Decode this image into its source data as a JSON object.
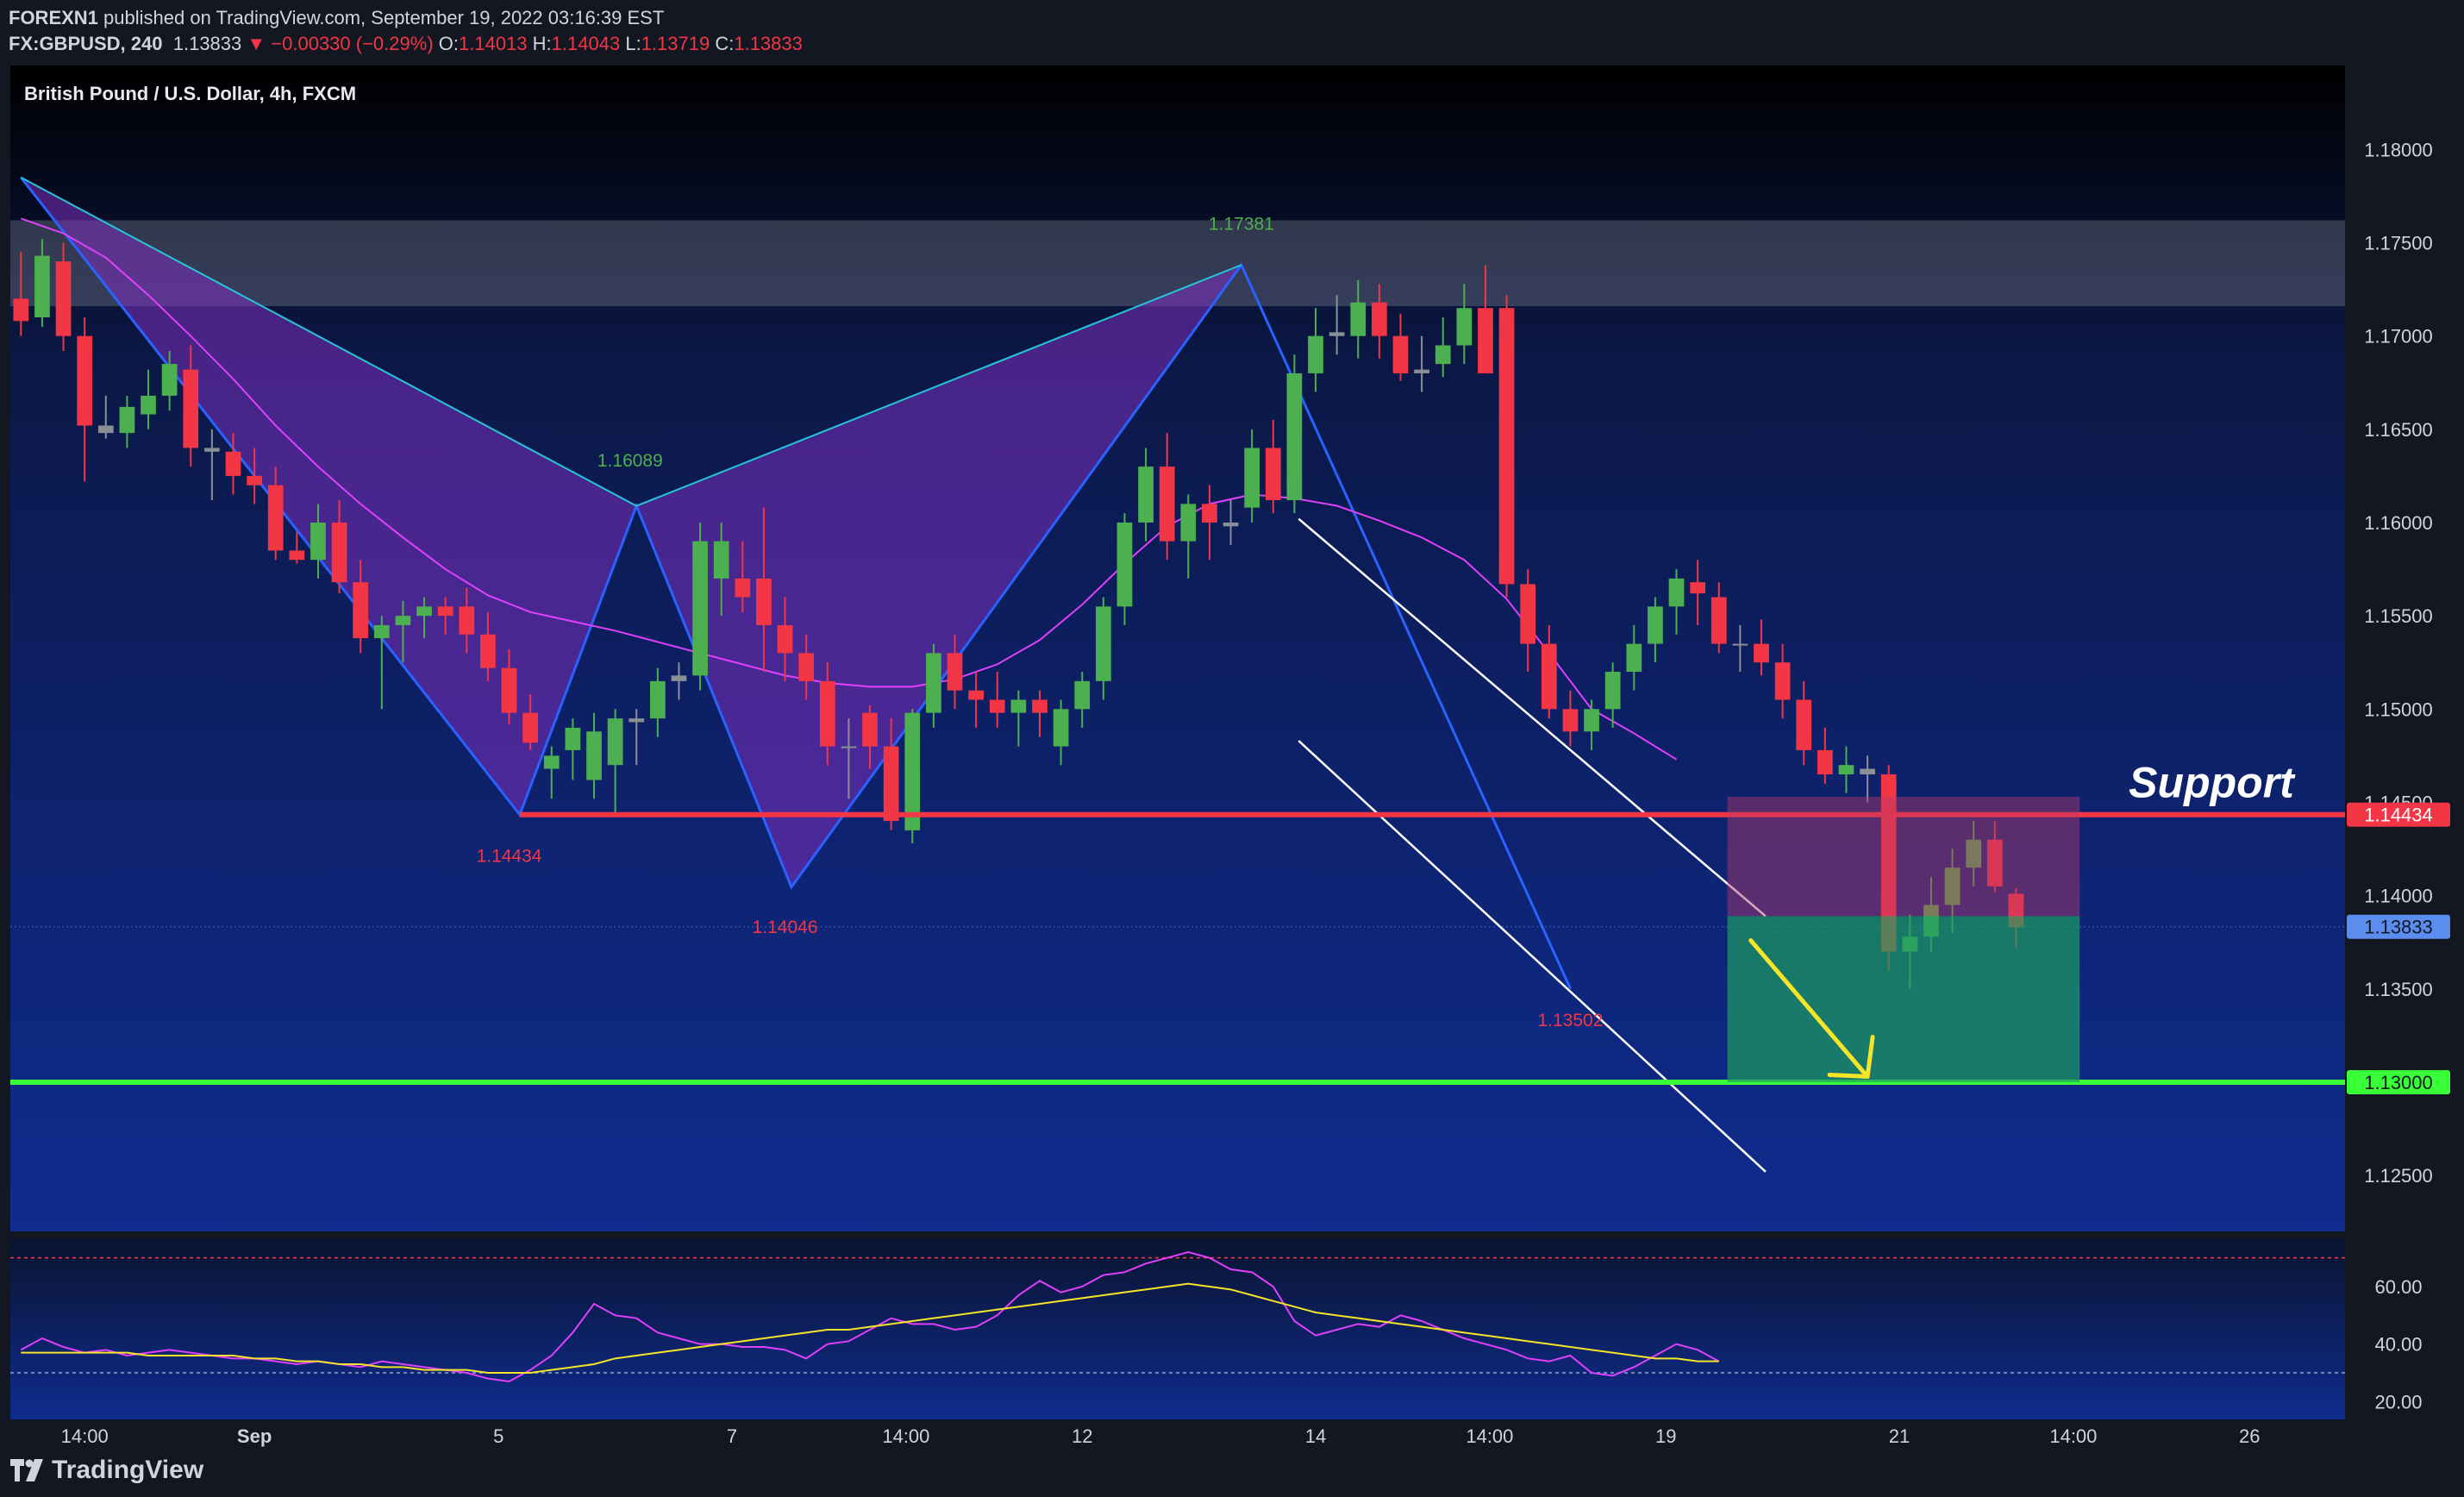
{
  "header": {
    "publisher": "FOREXN1",
    "published_text": "published on TradingView.com, September 19, 2022 03:16:39 EST",
    "symbol": "FX:GBPUSD, 240",
    "last": "1.13833",
    "change": "▼ −0.00330 (−0.29%)",
    "o_label": "O:",
    "o_value": "1.14013",
    "h_label": "H:",
    "h_value": "1.14043",
    "l_label": "L:",
    "l_value": "1.13719",
    "c_label": "C:",
    "c_value": "1.13833"
  },
  "chart_title": "British Pound / U.S. Dollar, 4h, FXCM",
  "footer": {
    "brand": "TradingView"
  },
  "colors": {
    "up": "#4caf50",
    "down": "#f23645",
    "neutral": "#8a8f96",
    "support": "#f23645",
    "target": "#39ff39",
    "pattern": "#2962ff",
    "ma": "#e040fb",
    "arrow": "#f5e428"
  },
  "chart_data": {
    "type": "candlestick",
    "y_axis": {
      "min": 1.122,
      "max": 1.1845,
      "ticks": [
        "1.18000",
        "1.17500",
        "1.17000",
        "1.16500",
        "1.16000",
        "1.15500",
        "1.15000",
        "1.14500",
        "1.14000",
        "1.13500",
        "1.13000",
        "1.12500"
      ]
    },
    "x_axis": {
      "bars": 110,
      "ticks": [
        {
          "label": "14:00",
          "bar": 3
        },
        {
          "label": "Sep",
          "bar": 11
        },
        {
          "label": "5",
          "bar": 22.5
        },
        {
          "label": "7",
          "bar": 33.5
        },
        {
          "label": "14:00",
          "bar": 41.7
        },
        {
          "label": "12",
          "bar": 50
        },
        {
          "label": "14",
          "bar": 61
        },
        {
          "label": "14:00",
          "bar": 69.2
        },
        {
          "label": "19",
          "bar": 77.5
        },
        {
          "label": "21",
          "bar": 88.5
        },
        {
          "label": "14:00",
          "bar": 96.7
        },
        {
          "label": "26",
          "bar": 105
        }
      ]
    },
    "resistance_zone": {
      "from": 1.1716,
      "to": 1.1762
    },
    "price_labels": [
      {
        "value": 1.14434,
        "text": "1.14434",
        "bg": "#f23645",
        "color": "#ffffff"
      },
      {
        "value": 1.13833,
        "text": "1.13833",
        "bg": "#5b8def",
        "color": "#131722"
      },
      {
        "value": 1.13,
        "text": "1.13000",
        "bg": "#39ff39",
        "color": "#131722"
      }
    ],
    "support_line": {
      "value": 1.14434,
      "from_bar": 23.5,
      "label": "Support"
    },
    "target_line": {
      "value": 1.13
    },
    "pivot_labels": [
      {
        "text": "1.17381",
        "bar": 57.5,
        "price": 1.1757,
        "color": "#4caf50"
      },
      {
        "text": "1.16089",
        "bar": 28.7,
        "price": 1.163,
        "color": "#4caf50"
      },
      {
        "text": "1.14434",
        "bar": 23,
        "price": 1.1418,
        "color": "#f23645"
      },
      {
        "text": "1.14046",
        "bar": 36,
        "price": 1.138,
        "color": "#f23645"
      },
      {
        "text": "1.13502",
        "bar": 73,
        "price": 1.133,
        "color": "#f23645"
      }
    ],
    "pattern_points": [
      {
        "bar": 0,
        "price": 1.1785
      },
      {
        "bar": 23.5,
        "price": 1.14434
      },
      {
        "bar": 29,
        "price": 1.16089
      },
      {
        "bar": 36.3,
        "price": 1.14046
      },
      {
        "bar": 57.5,
        "price": 1.17381
      },
      {
        "bar": 73,
        "price": 1.13502
      }
    ],
    "pattern_fill": "#7b2fbe",
    "channel": [
      {
        "from": {
          "bar": 60.2,
          "price": 1.1602
        },
        "to": {
          "bar": 82.2,
          "price": 1.1389
        }
      },
      {
        "from": {
          "bar": 60.2,
          "price": 1.1483
        },
        "to": {
          "bar": 82.2,
          "price": 1.1252
        }
      }
    ],
    "position": {
      "from_bar": 80.4,
      "to_bar": 97,
      "entry": 1.1389,
      "stop": 1.1453,
      "target": 1.13
    },
    "arrow": {
      "from": {
        "bar": 81.5,
        "price": 1.1376
      },
      "to": {
        "bar": 87,
        "price": 1.1303
      }
    },
    "ma": [
      [
        0,
        1.1763
      ],
      [
        2,
        1.1755
      ],
      [
        4,
        1.1742
      ],
      [
        6,
        1.1722
      ],
      [
        8,
        1.17
      ],
      [
        10,
        1.1677
      ],
      [
        12,
        1.1652
      ],
      [
        14,
        1.163
      ],
      [
        16,
        1.161
      ],
      [
        18,
        1.1592
      ],
      [
        20,
        1.1575
      ],
      [
        22,
        1.1561
      ],
      [
        24,
        1.1552
      ],
      [
        26,
        1.1547
      ],
      [
        28,
        1.1542
      ],
      [
        30,
        1.1536
      ],
      [
        32,
        1.153
      ],
      [
        34,
        1.1524
      ],
      [
        36,
        1.1518
      ],
      [
        38,
        1.1514
      ],
      [
        40,
        1.1512
      ],
      [
        42,
        1.1512
      ],
      [
        44,
        1.1516
      ],
      [
        46,
        1.1524
      ],
      [
        48,
        1.1537
      ],
      [
        50,
        1.1556
      ],
      [
        52,
        1.1578
      ],
      [
        54,
        1.1598
      ],
      [
        56,
        1.161
      ],
      [
        58,
        1.1615
      ],
      [
        60,
        1.1613
      ],
      [
        62,
        1.1609
      ],
      [
        64,
        1.1601
      ],
      [
        66,
        1.1592
      ],
      [
        68,
        1.158
      ],
      [
        70,
        1.1559
      ],
      [
        72,
        1.153
      ],
      [
        74,
        1.15
      ],
      [
        76,
        1.1487
      ],
      [
        78,
        1.1473
      ]
    ],
    "candles": [
      {
        "o": 1.172,
        "h": 1.1745,
        "l": 1.17,
        "c": 1.1708
      },
      {
        "o": 1.171,
        "h": 1.1752,
        "l": 1.1705,
        "c": 1.1743
      },
      {
        "o": 1.174,
        "h": 1.175,
        "l": 1.1692,
        "c": 1.17
      },
      {
        "o": 1.17,
        "h": 1.171,
        "l": 1.1622,
        "c": 1.1652
      },
      {
        "o": 1.1652,
        "h": 1.1668,
        "l": 1.1645,
        "c": 1.1648
      },
      {
        "o": 1.1648,
        "h": 1.1668,
        "l": 1.164,
        "c": 1.1662
      },
      {
        "o": 1.1658,
        "h": 1.1682,
        "l": 1.165,
        "c": 1.1668
      },
      {
        "o": 1.1668,
        "h": 1.1692,
        "l": 1.166,
        "c": 1.1685
      },
      {
        "o": 1.1682,
        "h": 1.1695,
        "l": 1.163,
        "c": 1.164
      },
      {
        "o": 1.164,
        "h": 1.165,
        "l": 1.1612,
        "c": 1.1638
      },
      {
        "o": 1.1638,
        "h": 1.1648,
        "l": 1.1615,
        "c": 1.1625
      },
      {
        "o": 1.1625,
        "h": 1.164,
        "l": 1.161,
        "c": 1.162
      },
      {
        "o": 1.162,
        "h": 1.163,
        "l": 1.158,
        "c": 1.1585
      },
      {
        "o": 1.1585,
        "h": 1.1595,
        "l": 1.1578,
        "c": 1.158
      },
      {
        "o": 1.158,
        "h": 1.161,
        "l": 1.157,
        "c": 1.16
      },
      {
        "o": 1.16,
        "h": 1.1612,
        "l": 1.1562,
        "c": 1.1568
      },
      {
        "o": 1.1568,
        "h": 1.158,
        "l": 1.153,
        "c": 1.1538
      },
      {
        "o": 1.1538,
        "h": 1.155,
        "l": 1.15,
        "c": 1.1545
      },
      {
        "o": 1.1545,
        "h": 1.1558,
        "l": 1.1525,
        "c": 1.155
      },
      {
        "o": 1.155,
        "h": 1.156,
        "l": 1.1538,
        "c": 1.1555
      },
      {
        "o": 1.1555,
        "h": 1.156,
        "l": 1.154,
        "c": 1.155
      },
      {
        "o": 1.1555,
        "h": 1.1565,
        "l": 1.153,
        "c": 1.154
      },
      {
        "o": 1.154,
        "h": 1.1552,
        "l": 1.1515,
        "c": 1.1522
      },
      {
        "o": 1.1522,
        "h": 1.1532,
        "l": 1.1492,
        "c": 1.1498
      },
      {
        "o": 1.1498,
        "h": 1.1508,
        "l": 1.1478,
        "c": 1.1482
      },
      {
        "o": 1.1468,
        "h": 1.148,
        "l": 1.1452,
        "c": 1.1475
      },
      {
        "o": 1.1478,
        "h": 1.1495,
        "l": 1.1462,
        "c": 1.149
      },
      {
        "o": 1.1462,
        "h": 1.1498,
        "l": 1.1452,
        "c": 1.1488
      },
      {
        "o": 1.147,
        "h": 1.15,
        "l": 1.1444,
        "c": 1.1495
      },
      {
        "o": 1.1493,
        "h": 1.15,
        "l": 1.147,
        "c": 1.1495
      },
      {
        "o": 1.1495,
        "h": 1.1522,
        "l": 1.1485,
        "c": 1.1515
      },
      {
        "o": 1.1515,
        "h": 1.1525,
        "l": 1.1505,
        "c": 1.1518
      },
      {
        "o": 1.1518,
        "h": 1.16,
        "l": 1.151,
        "c": 1.159
      },
      {
        "o": 1.157,
        "h": 1.16,
        "l": 1.155,
        "c": 1.159
      },
      {
        "o": 1.157,
        "h": 1.159,
        "l": 1.1552,
        "c": 1.156
      },
      {
        "o": 1.157,
        "h": 1.1608,
        "l": 1.152,
        "c": 1.1545
      },
      {
        "o": 1.1545,
        "h": 1.156,
        "l": 1.1515,
        "c": 1.153
      },
      {
        "o": 1.153,
        "h": 1.154,
        "l": 1.1505,
        "c": 1.1515
      },
      {
        "o": 1.1515,
        "h": 1.1525,
        "l": 1.147,
        "c": 1.148
      },
      {
        "o": 1.148,
        "h": 1.1495,
        "l": 1.1452,
        "c": 1.148
      },
      {
        "o": 1.1498,
        "h": 1.1502,
        "l": 1.1468,
        "c": 1.148
      },
      {
        "o": 1.148,
        "h": 1.1495,
        "l": 1.1435,
        "c": 1.144
      },
      {
        "o": 1.1435,
        "h": 1.15,
        "l": 1.1428,
        "c": 1.1498
      },
      {
        "o": 1.1498,
        "h": 1.1535,
        "l": 1.149,
        "c": 1.153
      },
      {
        "o": 1.153,
        "h": 1.154,
        "l": 1.15,
        "c": 1.151
      },
      {
        "o": 1.151,
        "h": 1.152,
        "l": 1.149,
        "c": 1.1505
      },
      {
        "o": 1.1505,
        "h": 1.152,
        "l": 1.149,
        "c": 1.1498
      },
      {
        "o": 1.1498,
        "h": 1.151,
        "l": 1.148,
        "c": 1.1505
      },
      {
        "o": 1.1505,
        "h": 1.151,
        "l": 1.1485,
        "c": 1.1498
      },
      {
        "o": 1.148,
        "h": 1.1505,
        "l": 1.147,
        "c": 1.15
      },
      {
        "o": 1.15,
        "h": 1.152,
        "l": 1.149,
        "c": 1.1515
      },
      {
        "o": 1.1515,
        "h": 1.156,
        "l": 1.1505,
        "c": 1.1555
      },
      {
        "o": 1.1555,
        "h": 1.1605,
        "l": 1.1545,
        "c": 1.16
      },
      {
        "o": 1.16,
        "h": 1.164,
        "l": 1.159,
        "c": 1.163
      },
      {
        "o": 1.163,
        "h": 1.1648,
        "l": 1.158,
        "c": 1.159
      },
      {
        "o": 1.159,
        "h": 1.1615,
        "l": 1.157,
        "c": 1.161
      },
      {
        "o": 1.161,
        "h": 1.162,
        "l": 1.158,
        "c": 1.16
      },
      {
        "o": 1.16,
        "h": 1.1612,
        "l": 1.1588,
        "c": 1.1598
      },
      {
        "o": 1.1608,
        "h": 1.165,
        "l": 1.16,
        "c": 1.164
      },
      {
        "o": 1.164,
        "h": 1.1655,
        "l": 1.1605,
        "c": 1.1612
      },
      {
        "o": 1.1612,
        "h": 1.169,
        "l": 1.1605,
        "c": 1.168
      },
      {
        "o": 1.168,
        "h": 1.1715,
        "l": 1.167,
        "c": 1.17
      },
      {
        "o": 1.17,
        "h": 1.1722,
        "l": 1.169,
        "c": 1.1702
      },
      {
        "o": 1.17,
        "h": 1.173,
        "l": 1.1688,
        "c": 1.1718
      },
      {
        "o": 1.1718,
        "h": 1.1728,
        "l": 1.1688,
        "c": 1.17
      },
      {
        "o": 1.17,
        "h": 1.1712,
        "l": 1.1676,
        "c": 1.168
      },
      {
        "o": 1.168,
        "h": 1.17,
        "l": 1.167,
        "c": 1.1682
      },
      {
        "o": 1.1685,
        "h": 1.171,
        "l": 1.1678,
        "c": 1.1695
      },
      {
        "o": 1.1695,
        "h": 1.1728,
        "l": 1.1685,
        "c": 1.1715
      },
      {
        "o": 1.1715,
        "h": 1.1738,
        "l": 1.17,
        "c": 1.168
      }
    ],
    "candles2": [
      {
        "o": 1.1715,
        "h": 1.1722,
        "l": 1.156,
        "c": 1.1567
      },
      {
        "o": 1.1567,
        "h": 1.1575,
        "l": 1.152,
        "c": 1.1535
      },
      {
        "o": 1.1535,
        "h": 1.1545,
        "l": 1.1495,
        "c": 1.15
      },
      {
        "o": 1.15,
        "h": 1.151,
        "l": 1.148,
        "c": 1.1488
      },
      {
        "o": 1.1488,
        "h": 1.1505,
        "l": 1.1478,
        "c": 1.15
      },
      {
        "o": 1.15,
        "h": 1.1525,
        "l": 1.149,
        "c": 1.152
      },
      {
        "o": 1.152,
        "h": 1.1545,
        "l": 1.151,
        "c": 1.1535
      },
      {
        "o": 1.1535,
        "h": 1.156,
        "l": 1.1525,
        "c": 1.1555
      },
      {
        "o": 1.1555,
        "h": 1.1575,
        "l": 1.154,
        "c": 1.157
      },
      {
        "o": 1.1568,
        "h": 1.158,
        "l": 1.1545,
        "c": 1.1562
      },
      {
        "o": 1.156,
        "h": 1.1568,
        "l": 1.153,
        "c": 1.1535
      },
      {
        "o": 1.1535,
        "h": 1.1545,
        "l": 1.152,
        "c": 1.1535
      },
      {
        "o": 1.1535,
        "h": 1.1548,
        "l": 1.1518,
        "c": 1.1525
      },
      {
        "o": 1.1525,
        "h": 1.1535,
        "l": 1.1495,
        "c": 1.1505
      },
      {
        "o": 1.1505,
        "h": 1.1515,
        "l": 1.147,
        "c": 1.1478
      },
      {
        "o": 1.1478,
        "h": 1.149,
        "l": 1.146,
        "c": 1.1465
      },
      {
        "o": 1.1465,
        "h": 1.148,
        "l": 1.1455,
        "c": 1.147
      },
      {
        "o": 1.1468,
        "h": 1.1475,
        "l": 1.145,
        "c": 1.1465
      },
      {
        "o": 1.1465,
        "h": 1.147,
        "l": 1.136,
        "c": 1.137
      },
      {
        "o": 1.137,
        "h": 1.139,
        "l": 1.135,
        "c": 1.1378
      },
      {
        "o": 1.1378,
        "h": 1.141,
        "l": 1.137,
        "c": 1.1395
      },
      {
        "o": 1.1395,
        "h": 1.1425,
        "l": 1.138,
        "c": 1.1415
      },
      {
        "o": 1.1415,
        "h": 1.144,
        "l": 1.1405,
        "c": 1.143
      },
      {
        "o": 1.143,
        "h": 1.144,
        "l": 1.1402,
        "c": 1.1405
      },
      {
        "o": 1.1401,
        "h": 1.1404,
        "l": 1.1372,
        "c": 1.1383
      }
    ],
    "rsi": {
      "ticks": [
        "60.00",
        "40.00",
        "20.00"
      ],
      "upper": 70,
      "lower": 30,
      "min": 15,
      "max": 75,
      "rsi": [
        38,
        42,
        39,
        37,
        38,
        36,
        37,
        38,
        37,
        36,
        35,
        35,
        34,
        33,
        34,
        33,
        32,
        34,
        33,
        32,
        31,
        30,
        28,
        27,
        31,
        36,
        44,
        54,
        50,
        49,
        44,
        42,
        40,
        40,
        39,
        39,
        38,
        35,
        40,
        41,
        45,
        49,
        47,
        47,
        45,
        46,
        50,
        57,
        62,
        58,
        60,
        64,
        65,
        68,
        70,
        72,
        70,
        66,
        65,
        60,
        48,
        43,
        45,
        47,
        46,
        50,
        48,
        45,
        42,
        40,
        38,
        35,
        34,
        36,
        30,
        29,
        32,
        36,
        40,
        38,
        34
      ],
      "signal": [
        37,
        37,
        37,
        37,
        37,
        37,
        36,
        36,
        36,
        36,
        36,
        35,
        35,
        34,
        34,
        33,
        33,
        32,
        32,
        31,
        31,
        31,
        30,
        30,
        30,
        31,
        32,
        33,
        35,
        36,
        37,
        38,
        39,
        40,
        41,
        42,
        43,
        44,
        45,
        45,
        46,
        47,
        48,
        49,
        50,
        51,
        52,
        53,
        54,
        55,
        56,
        57,
        58,
        59,
        60,
        61,
        60,
        59,
        57,
        55,
        53,
        51,
        50,
        49,
        48,
        47,
        46,
        45,
        44,
        43,
        42,
        41,
        40,
        39,
        38,
        37,
        36,
        35,
        35,
        34,
        34
      ]
    }
  }
}
